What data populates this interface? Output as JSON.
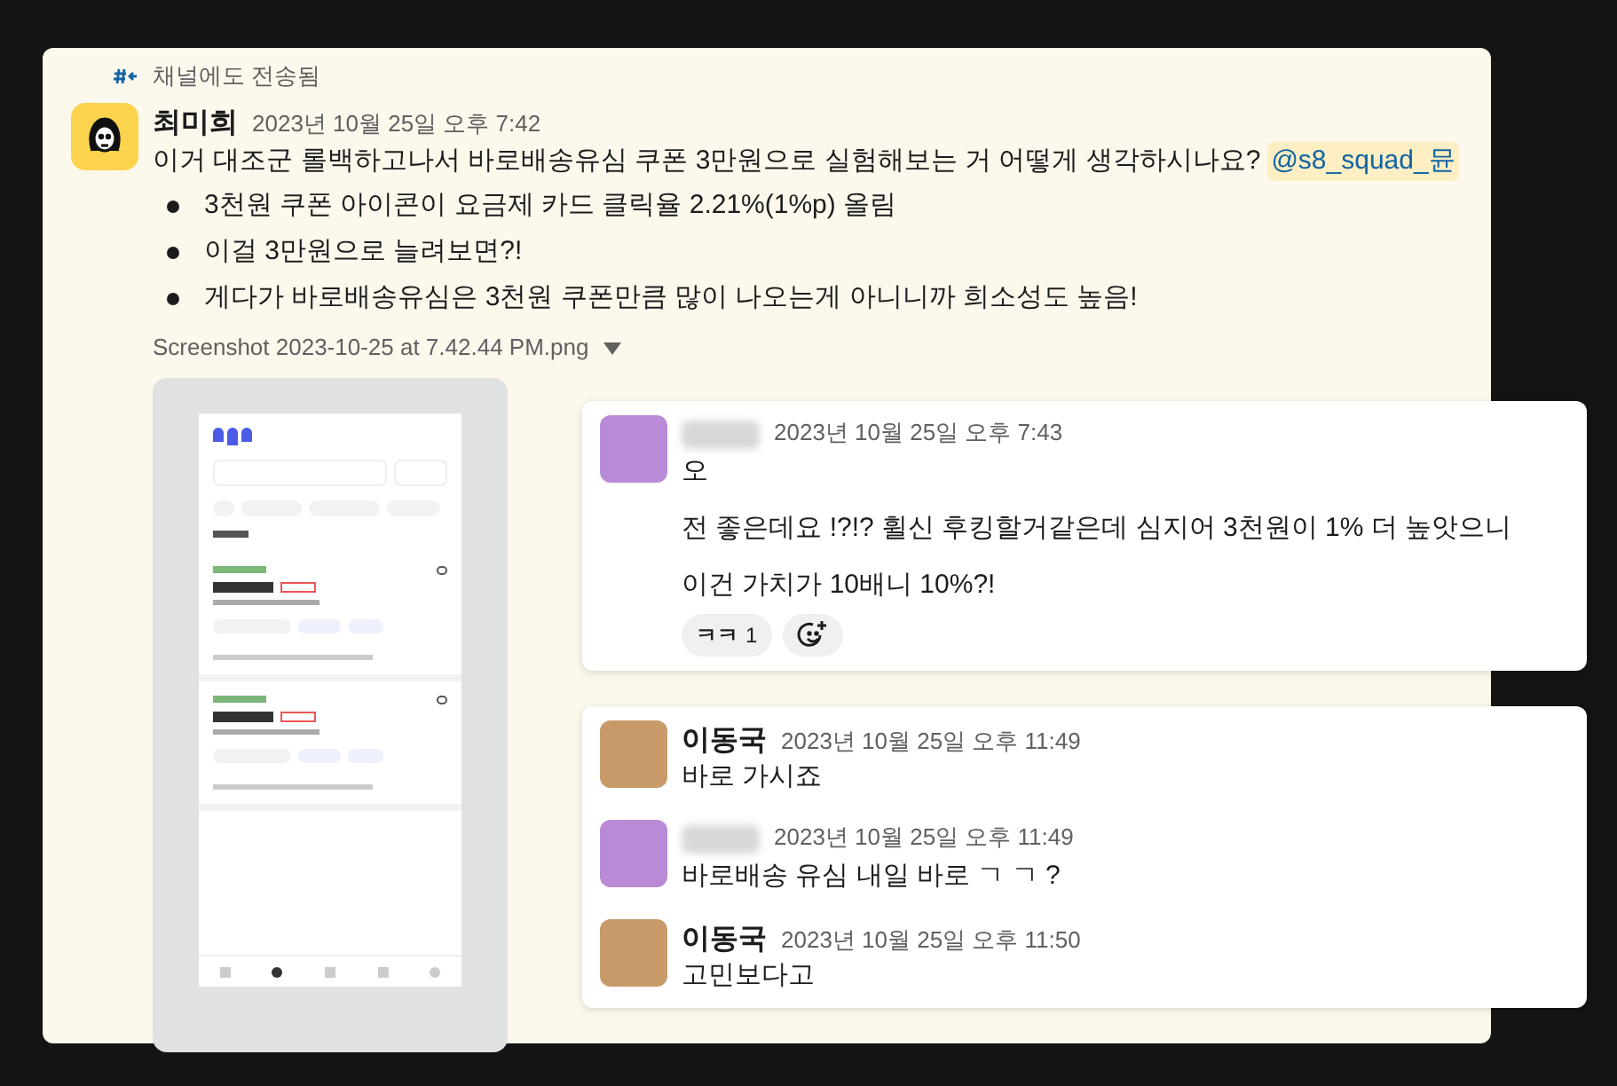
{
  "forwarded_label": "채널에도 전송됨",
  "message": {
    "author": "최미희",
    "time": "2023년 10월 25일 오후 7:42",
    "text": "이거 대조군 롤백하고나서 바로배송유심 쿠폰 3만원으로 실험해보는 거 어떻게 생각하시나요?",
    "mention": "@s8_squad_뮨",
    "bullets": [
      "3천원 쿠폰 아이콘이 요금제 카드 클릭율 2.21%(1%p) 올림",
      "이걸 3만원으로 늘려보면?!",
      "게다가 바로배송유심은 3천원 쿠폰만큼 많이 나오는게 아니니까 희소성도 높음!"
    ],
    "attachment": {
      "filename": "Screenshot 2023-10-25 at 7.42.44 PM.png"
    }
  },
  "reply_cards": [
    {
      "messages": [
        {
          "kind": "person",
          "time": "2023년 10월 25일 오후 7:43",
          "paragraphs": [
            "오",
            "전 좋은데요 !?!? 휠신 후킹할거같은데 심지어 3천원이 1% 더 높앗으니",
            "이건 가치가 10배니 10%?!"
          ]
        }
      ],
      "reactions": [
        {
          "emoji": "ㅋㅋ",
          "count": "1"
        }
      ]
    },
    {
      "messages": [
        {
          "kind": "dog",
          "author": "이동국",
          "time": "2023년 10월 25일 오후 11:49",
          "paragraphs": [
            "바로 가시죠"
          ]
        },
        {
          "kind": "person",
          "time": "2023년 10월 25일 오후 11:49",
          "paragraphs": [
            "바로배송 유심 내일 바로 ㄱ ㄱ ?"
          ]
        },
        {
          "kind": "dog",
          "author": "이동국",
          "time": "2023년 10월 25일 오후 11:50",
          "paragraphs": [
            "고민보다고"
          ]
        }
      ]
    }
  ]
}
